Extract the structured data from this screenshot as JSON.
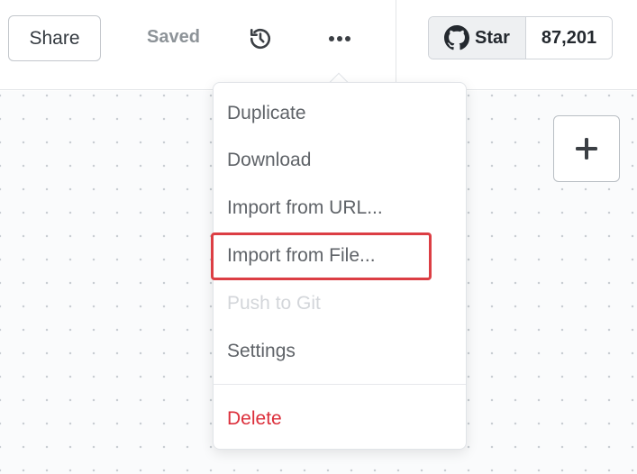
{
  "header": {
    "share_label": "Share",
    "saved_label": "Saved",
    "history_icon": "history-icon",
    "more_icon": "more-horizontal-icon"
  },
  "github": {
    "star_label": "Star",
    "star_count": "87,201",
    "icon": "github-icon"
  },
  "canvas": {
    "add_icon": "plus-icon"
  },
  "menu": {
    "items": [
      {
        "label": "Duplicate",
        "state": "normal"
      },
      {
        "label": "Download",
        "state": "normal"
      },
      {
        "label": "Import from URL...",
        "state": "normal"
      },
      {
        "label": "Import from File...",
        "state": "highlighted"
      },
      {
        "label": "Push to Git",
        "state": "disabled"
      },
      {
        "label": "Settings",
        "state": "normal"
      }
    ],
    "delete_label": "Delete"
  },
  "colors": {
    "danger": "#dc2f3b",
    "highlight_box": "#dc3e44",
    "muted_text": "#8d9398"
  }
}
